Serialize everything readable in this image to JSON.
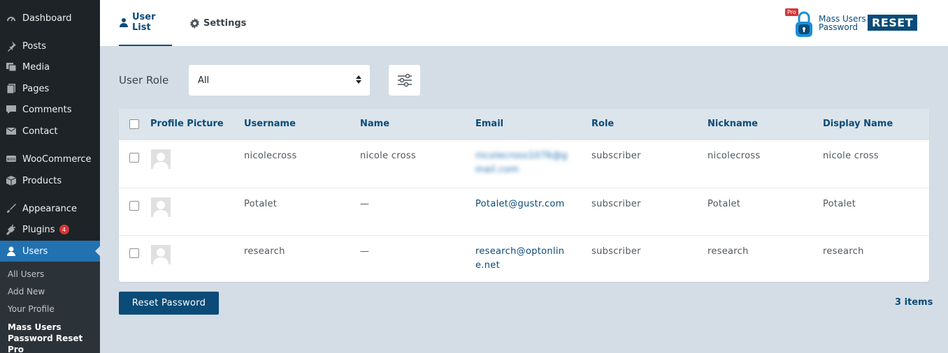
{
  "sidebar": {
    "items": [
      {
        "label": "Dashboard",
        "icon": "dashboard-icon"
      },
      {
        "label": "Posts",
        "icon": "pin-icon"
      },
      {
        "label": "Media",
        "icon": "media-icon"
      },
      {
        "label": "Pages",
        "icon": "pages-icon"
      },
      {
        "label": "Comments",
        "icon": "comment-icon"
      },
      {
        "label": "Contact",
        "icon": "mail-icon"
      },
      {
        "label": "WooCommerce",
        "icon": "woo-icon"
      },
      {
        "label": "Products",
        "icon": "box-icon"
      },
      {
        "label": "Appearance",
        "icon": "brush-icon"
      },
      {
        "label": "Plugins",
        "icon": "plug-icon",
        "badge": "4"
      },
      {
        "label": "Users",
        "icon": "user-icon"
      }
    ],
    "submenu": [
      "All Users",
      "Add New",
      "Your Profile",
      "Mass Users Password Reset Pro"
    ]
  },
  "tabs": {
    "user_list": "User List",
    "settings": "Settings"
  },
  "logo": {
    "pro": "Pro",
    "line1": "Mass Users",
    "line2": "Password",
    "reset": "RESET"
  },
  "filter": {
    "label": "User Role",
    "selected": "All"
  },
  "table": {
    "headers": [
      "Profile Picture",
      "Username",
      "Name",
      "Email",
      "Role",
      "Nickname",
      "Display Name"
    ],
    "rows": [
      {
        "username": "nicolecross",
        "name": "nicole cross",
        "email": "nicolecross1076@gmail.com",
        "role": "subscriber",
        "nickname": "nicolecross",
        "display": "nicole cross"
      },
      {
        "username": "Potalet",
        "name": "—",
        "email": "Potalet@gustr.com",
        "role": "subscriber",
        "nickname": "Potalet",
        "display": "Potalet"
      },
      {
        "username": "research",
        "name": "—",
        "email": "research@optonline.net",
        "role": "subscriber",
        "nickname": "research",
        "display": "research"
      }
    ]
  },
  "actions": {
    "reset_password": "Reset Password",
    "items_count": "3 items"
  },
  "colors": {
    "sidebar_bg": "#1d2327",
    "accent": "#2271b1",
    "primary_dark": "#0a4b78",
    "page_bg": "#d4dde5"
  }
}
